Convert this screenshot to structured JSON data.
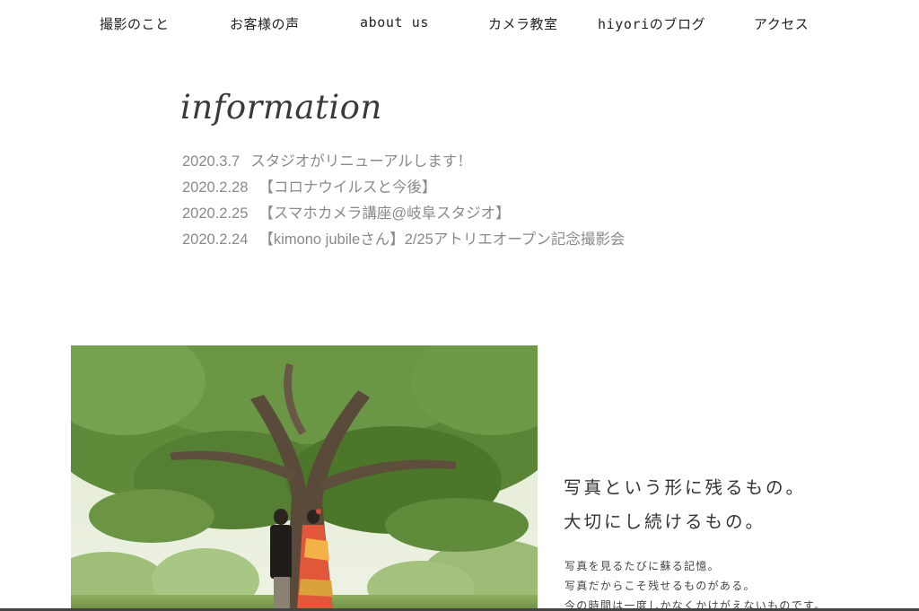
{
  "nav": {
    "items": [
      {
        "label": "撮影のこと"
      },
      {
        "label": "お客様の声"
      },
      {
        "label": "about us"
      },
      {
        "label": "カメラ教室"
      },
      {
        "label": "hiyoriのブログ"
      },
      {
        "label": "アクセス"
      }
    ]
  },
  "information": {
    "title": "information",
    "news": [
      {
        "date": "2020.3.7",
        "title": "スタジオがリニューアルします！"
      },
      {
        "date": "2020.2.28",
        "title": "【コロナウイルスと今後】"
      },
      {
        "date": "2020.2.25",
        "title": "【スマホカメラ講座@岐阜スタジオ】"
      },
      {
        "date": "2020.2.24",
        "title": "【kimono jubileさん】2/25アトリエオープン記念撮影会"
      }
    ]
  },
  "about": {
    "tagline_line1": "写真という形に残るもの。",
    "tagline_line2": "大切にし続けるもの。",
    "body_line1": "写真を見るたびに蘇る記憶。",
    "body_line2": "写真だからこそ残せるものがある。",
    "body_line3": "今の時間は一度しかなくかけがえないものです。"
  },
  "colors": {
    "news_text": "#8a8a8a",
    "foliage": "#5e8a3a",
    "kimono": "#e0573a"
  }
}
